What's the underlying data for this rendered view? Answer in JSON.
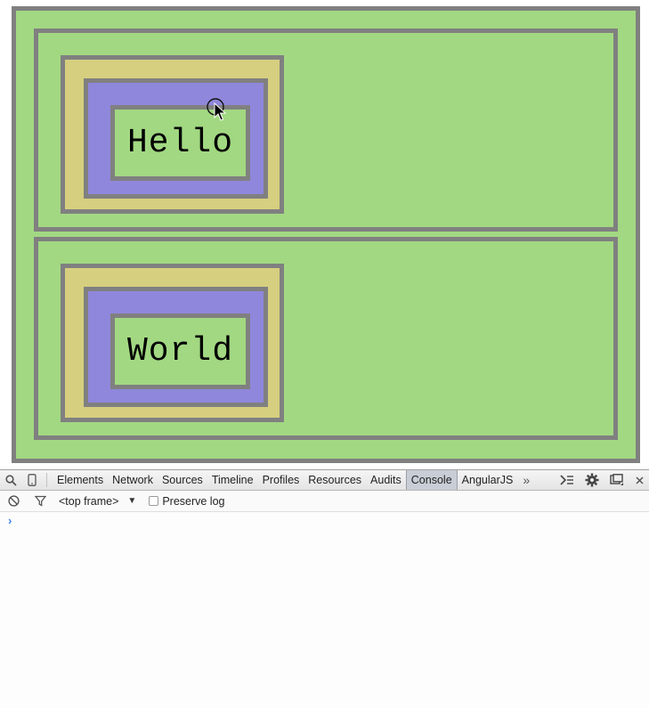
{
  "page": {
    "boxes": [
      {
        "id": "row1",
        "text": "Hello"
      },
      {
        "id": "row2",
        "text": "World"
      }
    ],
    "colors": {
      "green": "#a2d882",
      "yellow": "#d6cf7f",
      "purple": "#8f87db",
      "border": "#808080"
    }
  },
  "devtools": {
    "icons": [
      "search-icon",
      "device-icon"
    ],
    "tabs": [
      {
        "label": "Elements"
      },
      {
        "label": "Network"
      },
      {
        "label": "Sources"
      },
      {
        "label": "Timeline"
      },
      {
        "label": "Profiles"
      },
      {
        "label": "Resources"
      },
      {
        "label": "Audits"
      },
      {
        "label": "Console",
        "active": true
      },
      {
        "label": "AngularJS"
      }
    ],
    "more_label": "»",
    "right_icons": [
      "drawer-icon",
      "gear-icon",
      "dock-icon",
      "close-icon"
    ],
    "frame_selector": "<top frame>",
    "preserve_log_label": "Preserve log",
    "preserve_log_checked": false,
    "prompt": "›"
  }
}
